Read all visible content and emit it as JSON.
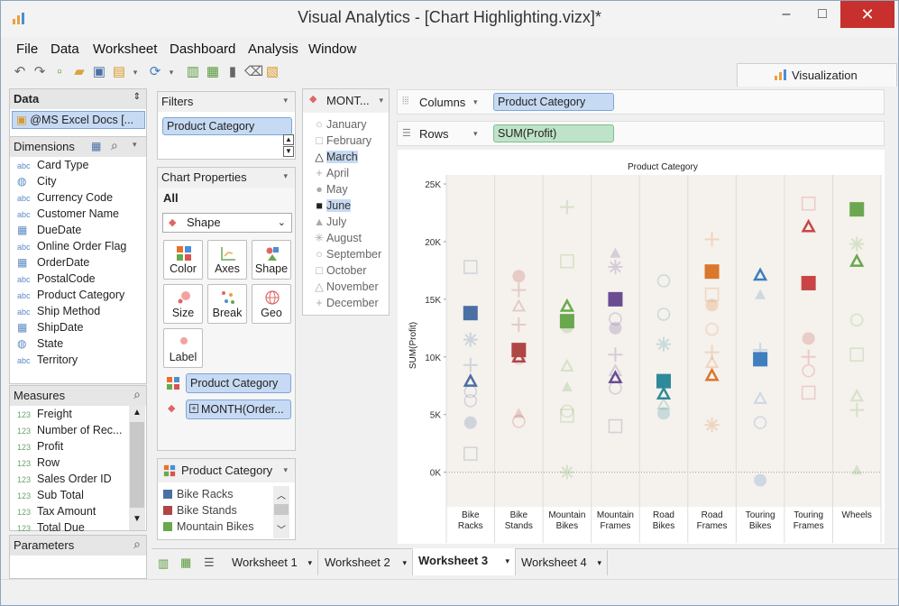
{
  "window": {
    "title": "Visual Analytics - [Chart Highlighting.vizx]*"
  },
  "menu": [
    "File",
    "Data",
    "Worksheet",
    "Dashboard",
    "Analysis",
    "Window"
  ],
  "viz_tab": "Visualization",
  "data_pane": {
    "title": "Data",
    "source": "@MS Excel Docs [...",
    "dimensions_title": "Dimensions",
    "dimensions": [
      {
        "type": "abc",
        "name": "Card Type"
      },
      {
        "type": "geo",
        "name": "City"
      },
      {
        "type": "abc",
        "name": "Currency Code"
      },
      {
        "type": "abc",
        "name": "Customer Name"
      },
      {
        "type": "date",
        "name": "DueDate"
      },
      {
        "type": "abc",
        "name": "Online Order Flag"
      },
      {
        "type": "date",
        "name": "OrderDate"
      },
      {
        "type": "abc",
        "name": "PostalCode"
      },
      {
        "type": "abc",
        "name": "Product Category"
      },
      {
        "type": "abc",
        "name": "Ship Method"
      },
      {
        "type": "date",
        "name": "ShipDate"
      },
      {
        "type": "geo",
        "name": "State"
      },
      {
        "type": "abc",
        "name": "Territory"
      }
    ],
    "measures_title": "Measures",
    "measures": [
      {
        "type": "123",
        "name": "Freight"
      },
      {
        "type": "123",
        "name": "Number of Rec..."
      },
      {
        "type": "123",
        "name": "Profit"
      },
      {
        "type": "123",
        "name": "Row"
      },
      {
        "type": "123",
        "name": "Sales Order ID"
      },
      {
        "type": "123",
        "name": "Sub Total"
      },
      {
        "type": "123",
        "name": "Tax Amount"
      },
      {
        "type": "123",
        "name": "Total Due"
      }
    ],
    "parameters_title": "Parameters"
  },
  "filters": {
    "title": "Filters",
    "items": [
      "Product Category"
    ]
  },
  "chart_properties": {
    "title": "Chart Properties",
    "scope": "All",
    "mark_type": "Shape",
    "buttons": [
      "Color",
      "Axes",
      "Shape",
      "Size",
      "Break",
      "Geo",
      "Label"
    ],
    "color_pill": "Product Category",
    "shape_pill": "MONTH(Order..."
  },
  "legend": {
    "title": "Product Category",
    "items": [
      {
        "name": "Bike Racks",
        "color": "#4a6fa5"
      },
      {
        "name": "Bike Stands",
        "color": "#b04646"
      },
      {
        "name": "Mountain Bikes",
        "color": "#6aa84f"
      }
    ]
  },
  "month_legend": {
    "title": "MONT...",
    "items": [
      {
        "name": "January",
        "sym": "○"
      },
      {
        "name": "February",
        "sym": "□"
      },
      {
        "name": "March",
        "sym": "△",
        "hl": true
      },
      {
        "name": "April",
        "sym": "+"
      },
      {
        "name": "May",
        "sym": "●"
      },
      {
        "name": "June",
        "sym": "■",
        "hl": true
      },
      {
        "name": "July",
        "sym": "▲"
      },
      {
        "name": "August",
        "sym": "✳"
      },
      {
        "name": "September",
        "sym": "○"
      },
      {
        "name": "October",
        "sym": "□"
      },
      {
        "name": "November",
        "sym": "△"
      },
      {
        "name": "December",
        "sym": "+"
      }
    ]
  },
  "shelves": {
    "columns_label": "Columns",
    "columns_pill": "Product Category",
    "rows_label": "Rows",
    "rows_pill": "SUM(Profit)"
  },
  "tabs": [
    "Worksheet 1",
    "Worksheet 2",
    "Worksheet 3",
    "Worksheet 4"
  ],
  "active_tab": "Worksheet 3",
  "chart_data": {
    "type": "scatter",
    "title": "Product Category",
    "xlabel": "",
    "ylabel": "SUM(Profit)",
    "ylim": [
      -3000,
      25000
    ],
    "yticks": [
      "25K",
      "20K",
      "15K",
      "10K",
      "5K",
      "0K"
    ],
    "categories": [
      "Bike Racks",
      "Bike Stands",
      "Mountain Bikes",
      "Mountain Frames",
      "Road Bikes",
      "Road Frames",
      "Touring Bikes",
      "Touring Frames",
      "Wheels"
    ],
    "category_lines": [
      [
        "Bike",
        "Racks"
      ],
      [
        "Bike",
        "Stands"
      ],
      [
        "Mountain",
        "Bikes"
      ],
      [
        "Mountain",
        "Frames"
      ],
      [
        "Road",
        "Bikes"
      ],
      [
        "Road",
        "Frames"
      ],
      [
        "Touring",
        "Bikes"
      ],
      [
        "Touring",
        "Frames"
      ],
      [
        "Wheels"
      ]
    ],
    "colors": [
      "#4a6fa5",
      "#b04646",
      "#6aa84f",
      "#6a4c93",
      "#2e8a9a",
      "#d9772b",
      "#3f7fbf",
      "#c94545",
      "#6aa84f"
    ],
    "highlighted_months": [
      "March",
      "June"
    ],
    "points": [
      {
        "cat": 0,
        "month": "June",
        "y": 13800
      },
      {
        "cat": 0,
        "month": "March",
        "y": 7900
      },
      {
        "cat": 0,
        "month": "October",
        "y": 17800
      },
      {
        "cat": 0,
        "month": "August",
        "y": 11500
      },
      {
        "cat": 0,
        "month": "April",
        "y": 9300
      },
      {
        "cat": 0,
        "month": "January",
        "y": 7000
      },
      {
        "cat": 0,
        "month": "September",
        "y": 6200
      },
      {
        "cat": 0,
        "month": "May",
        "y": 4300
      },
      {
        "cat": 0,
        "month": "February",
        "y": 1600
      },
      {
        "cat": 1,
        "month": "June",
        "y": 10600
      },
      {
        "cat": 1,
        "month": "March",
        "y": 10000
      },
      {
        "cat": 1,
        "month": "May",
        "y": 17000
      },
      {
        "cat": 1,
        "month": "April",
        "y": 15800
      },
      {
        "cat": 1,
        "month": "November",
        "y": 14400
      },
      {
        "cat": 1,
        "month": "December",
        "y": 12800
      },
      {
        "cat": 1,
        "month": "September",
        "y": 9900
      },
      {
        "cat": 1,
        "month": "July",
        "y": 5100
      },
      {
        "cat": 1,
        "month": "January",
        "y": 4400
      },
      {
        "cat": 2,
        "month": "June",
        "y": 13100
      },
      {
        "cat": 2,
        "month": "March",
        "y": 14400
      },
      {
        "cat": 2,
        "month": "December",
        "y": 23000
      },
      {
        "cat": 2,
        "month": "October",
        "y": 18300
      },
      {
        "cat": 2,
        "month": "May",
        "y": 12600
      },
      {
        "cat": 2,
        "month": "November",
        "y": 9200
      },
      {
        "cat": 2,
        "month": "July",
        "y": 7400
      },
      {
        "cat": 2,
        "month": "September",
        "y": 5300
      },
      {
        "cat": 2,
        "month": "February",
        "y": 4900
      },
      {
        "cat": 2,
        "month": "August",
        "y": 0
      },
      {
        "cat": 3,
        "month": "June",
        "y": 15000
      },
      {
        "cat": 3,
        "month": "March",
        "y": 8200
      },
      {
        "cat": 3,
        "month": "July",
        "y": 19000
      },
      {
        "cat": 3,
        "month": "August",
        "y": 17800
      },
      {
        "cat": 3,
        "month": "January",
        "y": 13300
      },
      {
        "cat": 3,
        "month": "May",
        "y": 12500
      },
      {
        "cat": 3,
        "month": "April",
        "y": 10200
      },
      {
        "cat": 3,
        "month": "November",
        "y": 8800
      },
      {
        "cat": 3,
        "month": "September",
        "y": 7300
      },
      {
        "cat": 3,
        "month": "February",
        "y": 4000
      },
      {
        "cat": 4,
        "month": "June",
        "y": 7900
      },
      {
        "cat": 4,
        "month": "March",
        "y": 6800
      },
      {
        "cat": 4,
        "month": "January",
        "y": 16600
      },
      {
        "cat": 4,
        "month": "September",
        "y": 13700
      },
      {
        "cat": 4,
        "month": "August",
        "y": 11100
      },
      {
        "cat": 4,
        "month": "November",
        "y": 5900
      },
      {
        "cat": 4,
        "month": "May",
        "y": 5100
      },
      {
        "cat": 5,
        "month": "June",
        "y": 17400
      },
      {
        "cat": 5,
        "month": "March",
        "y": 8400
      },
      {
        "cat": 5,
        "month": "December",
        "y": 20200
      },
      {
        "cat": 5,
        "month": "February",
        "y": 15400
      },
      {
        "cat": 5,
        "month": "May",
        "y": 14500
      },
      {
        "cat": 5,
        "month": "January",
        "y": 12400
      },
      {
        "cat": 5,
        "month": "April",
        "y": 10400
      },
      {
        "cat": 5,
        "month": "November",
        "y": 9500
      },
      {
        "cat": 5,
        "month": "August",
        "y": 4100
      },
      {
        "cat": 6,
        "month": "June",
        "y": 9800
      },
      {
        "cat": 6,
        "month": "March",
        "y": 17100
      },
      {
        "cat": 6,
        "month": "July",
        "y": 15400
      },
      {
        "cat": 6,
        "month": "December",
        "y": 10600
      },
      {
        "cat": 6,
        "month": "November",
        "y": 6400
      },
      {
        "cat": 6,
        "month": "September",
        "y": 4300
      },
      {
        "cat": 6,
        "month": "May",
        "y": -700
      },
      {
        "cat": 7,
        "month": "June",
        "y": 16400
      },
      {
        "cat": 7,
        "month": "March",
        "y": 21300
      },
      {
        "cat": 7,
        "month": "February",
        "y": 23300
      },
      {
        "cat": 7,
        "month": "May",
        "y": 11600
      },
      {
        "cat": 7,
        "month": "April",
        "y": 10000
      },
      {
        "cat": 7,
        "month": "January",
        "y": 8800
      },
      {
        "cat": 7,
        "month": "October",
        "y": 6900
      },
      {
        "cat": 8,
        "month": "June",
        "y": 22800
      },
      {
        "cat": 8,
        "month": "March",
        "y": 18300
      },
      {
        "cat": 8,
        "month": "August",
        "y": 19800
      },
      {
        "cat": 8,
        "month": "September",
        "y": 13200
      },
      {
        "cat": 8,
        "month": "October",
        "y": 10200
      },
      {
        "cat": 8,
        "month": "November",
        "y": 6600
      },
      {
        "cat": 8,
        "month": "April",
        "y": 5400
      },
      {
        "cat": 8,
        "month": "July",
        "y": 200
      }
    ]
  }
}
